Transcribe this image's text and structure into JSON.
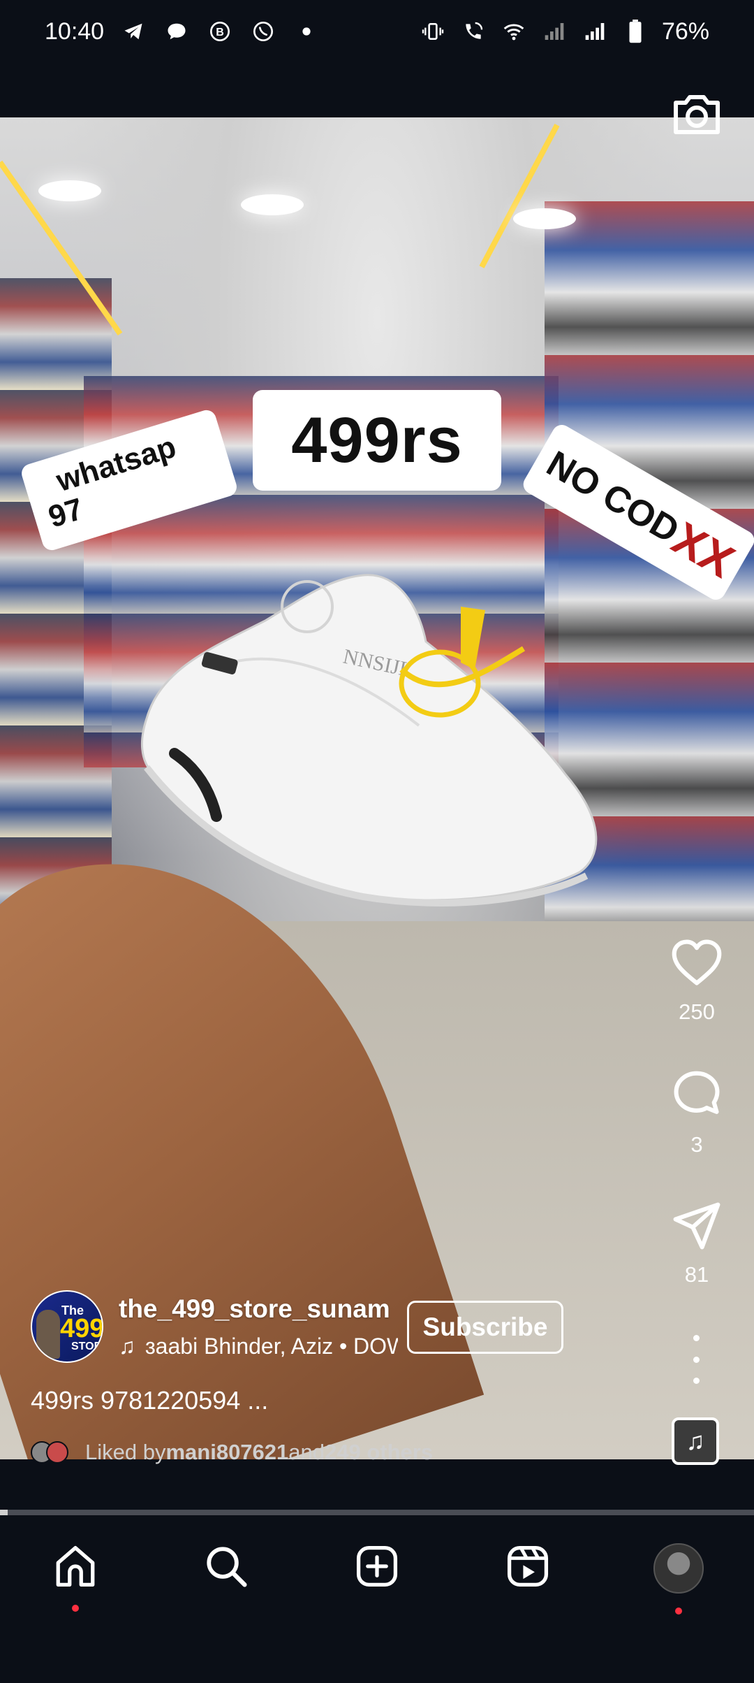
{
  "status_bar": {
    "time": "10:40",
    "battery": "76%",
    "left_icons": [
      "telegram-icon",
      "chat-bubble-icon",
      "business-icon",
      "whatsapp-icon",
      "dot-icon"
    ],
    "right_icons": [
      "vibrate-icon",
      "wifi-call-icon",
      "wifi-icon",
      "signal-icon",
      "signal-icon",
      "battery-icon"
    ]
  },
  "reel": {
    "stickers": {
      "price": "499rs",
      "whatsapp_line1": "whatsap",
      "whatsapp_line2": "97",
      "cod_text": "NO COD",
      "cod_marks": "XX"
    },
    "actions": {
      "likes": "250",
      "comments": "3",
      "shares": "81"
    },
    "author": {
      "username": "the_499_store_sunam",
      "avatar_top": "The",
      "avatar_number": "499",
      "avatar_bottom": "STOR",
      "subscribe_label": "Subscribe"
    },
    "music": {
      "track": "ɜaabi Bhinder, Aziz • DOW"
    },
    "caption": "499rs 9781220594 ...",
    "liked_by": {
      "prefix": "Liked by ",
      "user": "mani807621",
      "middle": " and ",
      "others": "249 others"
    },
    "progress": 0.01
  },
  "bottom_nav": {
    "items": [
      "home-icon",
      "search-icon",
      "create-icon",
      "reels-icon",
      "profile-avatar"
    ]
  },
  "colors": {
    "background": "#0b0f17",
    "notification_dot": "#ff3040",
    "cod_marks": "#b71c1c"
  }
}
